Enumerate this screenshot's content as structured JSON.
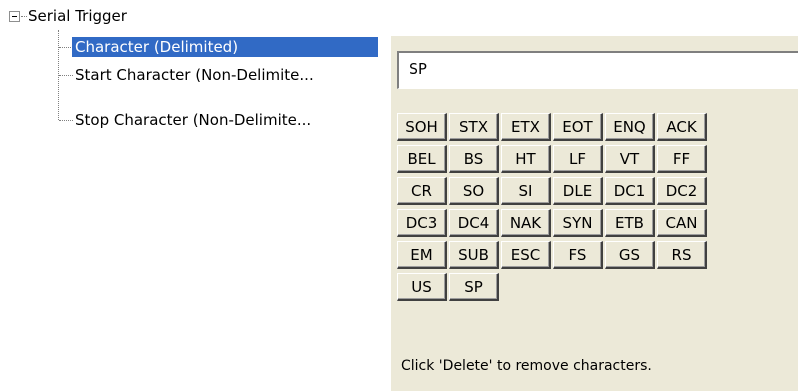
{
  "tree": {
    "root_label": "Serial Trigger",
    "items": [
      {
        "label": "Character (Delimited)",
        "selected": true
      },
      {
        "label": "Start Character (Non-Delimite...",
        "selected": false
      },
      {
        "label": "Stop Character (Non-Delimite...",
        "selected": false
      }
    ]
  },
  "panel": {
    "input_value": "SP",
    "keys": [
      "SOH",
      "STX",
      "ETX",
      "EOT",
      "ENQ",
      "ACK",
      "BEL",
      "BS",
      "HT",
      "LF",
      "VT",
      "FF",
      "CR",
      "SO",
      "SI",
      "DLE",
      "DC1",
      "DC2",
      "DC3",
      "DC4",
      "NAK",
      "SYN",
      "ETB",
      "CAN",
      "EM",
      "SUB",
      "ESC",
      "FS",
      "GS",
      "RS",
      "US",
      "SP"
    ],
    "hint": "Click 'Delete' to remove characters."
  },
  "colors": {
    "selection": "#316ac5",
    "panel_bg": "#ece9d8"
  }
}
